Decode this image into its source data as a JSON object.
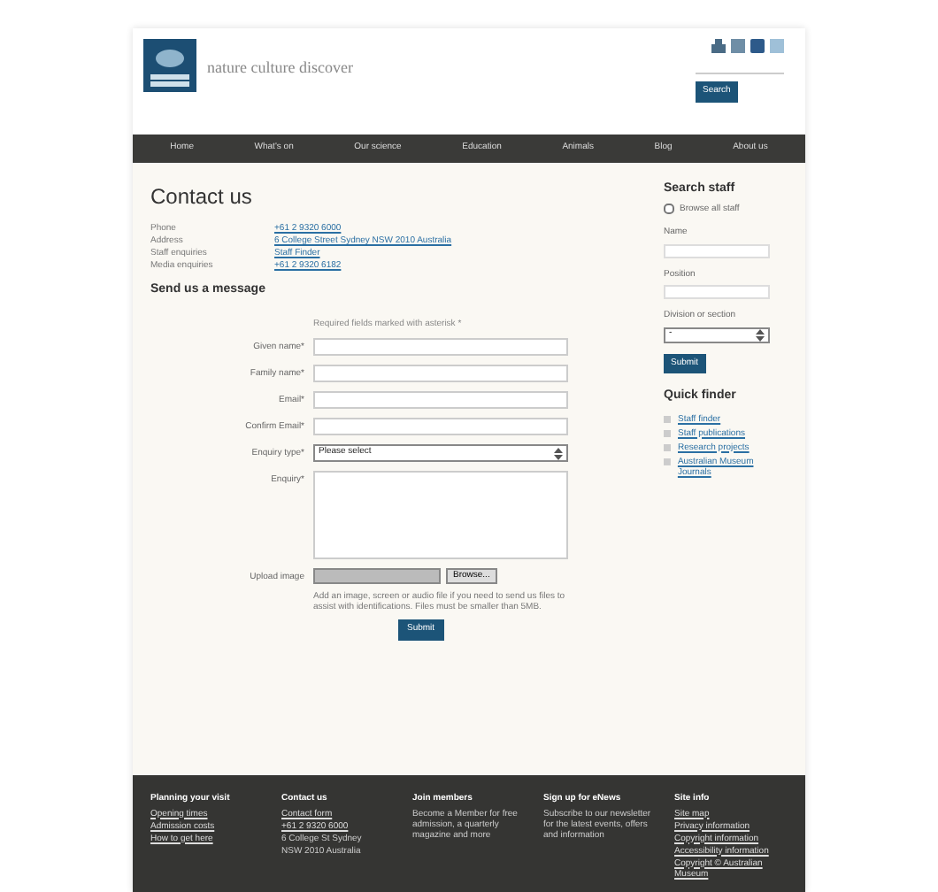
{
  "header": {
    "tagline": "nature culture discover",
    "search_button": "Search"
  },
  "nav": [
    {
      "label": "Home"
    },
    {
      "label": "What's on"
    },
    {
      "label": "Our science"
    },
    {
      "label": "Education"
    },
    {
      "label": "Animals"
    },
    {
      "label": "Blog"
    },
    {
      "label": "About us"
    }
  ],
  "contact": {
    "title": "Contact us",
    "rows": [
      {
        "label": "Phone",
        "value": "+61 2 9320 6000",
        "link": true
      },
      {
        "label": "Address",
        "value": "6 College Street Sydney NSW 2010 Australia",
        "link": true
      },
      {
        "label": "Staff enquiries",
        "value": "Staff Finder",
        "link": true
      },
      {
        "label": "Media enquiries",
        "value": "+61 2 9320 6182",
        "link": true
      }
    ]
  },
  "form": {
    "title": "Send us a message",
    "note": "Required fields marked with asterisk *",
    "fields": [
      {
        "kind": "text",
        "label": "Given name*"
      },
      {
        "kind": "text",
        "label": "Family name*"
      },
      {
        "kind": "text",
        "label": "Email*"
      },
      {
        "kind": "text",
        "label": "Confirm Email*"
      },
      {
        "kind": "select",
        "label": "Enquiry type*",
        "value": "Please select"
      },
      {
        "kind": "textarea",
        "label": "Enquiry*"
      },
      {
        "kind": "file",
        "label": "Upload image",
        "button": "Browse..."
      }
    ],
    "help": "Add an image, screen or audio file if you need to send us files to assist with identifications. Files must be smaller than 5MB.",
    "submit": "Submit"
  },
  "sidebar": {
    "title": "Search staff",
    "browse_all": {
      "label": "Browse all staff",
      "checked": false
    },
    "fields": [
      {
        "kind": "text",
        "label": "Name"
      },
      {
        "kind": "text",
        "label": "Position"
      },
      {
        "kind": "select",
        "label": "Division or section",
        "value": "-"
      }
    ],
    "submit": "Submit",
    "quick_title": "Quick finder",
    "quick_links": [
      {
        "label": "Staff finder"
      },
      {
        "label": "Staff publications"
      },
      {
        "label": "Research projects"
      },
      {
        "label": "Australian Museum Journals"
      }
    ]
  },
  "footer": [
    {
      "title": "Planning your visit",
      "lines": [
        {
          "text": "Opening times",
          "link": true
        },
        {
          "text": "Admission costs",
          "link": true
        },
        {
          "text": "How to get here",
          "link": true
        }
      ]
    },
    {
      "title": "Contact us",
      "lines": [
        {
          "text": "Contact form",
          "link": true
        },
        {
          "text": "+61 2 9320 6000",
          "link": true
        },
        {
          "text": "6 College St Sydney",
          "link": false
        },
        {
          "text": "NSW 2010 Australia",
          "link": false
        }
      ]
    },
    {
      "title": "Join members",
      "lines": [
        {
          "text": "Become a Member for free admission, a quarterly magazine and more",
          "link": false
        }
      ]
    },
    {
      "title": "Sign up for eNews",
      "lines": [
        {
          "text": "Subscribe to our newsletter for the latest events, offers and information",
          "link": false
        }
      ]
    },
    {
      "title": "Site info",
      "lines": [
        {
          "text": "Site map",
          "link": true
        },
        {
          "text": "Privacy information",
          "link": true
        },
        {
          "text": "Copyright information",
          "link": true
        },
        {
          "text": "Accessibility information",
          "link": true
        },
        {
          "text": "Copyright © Australian Museum",
          "link": true
        }
      ]
    }
  ]
}
